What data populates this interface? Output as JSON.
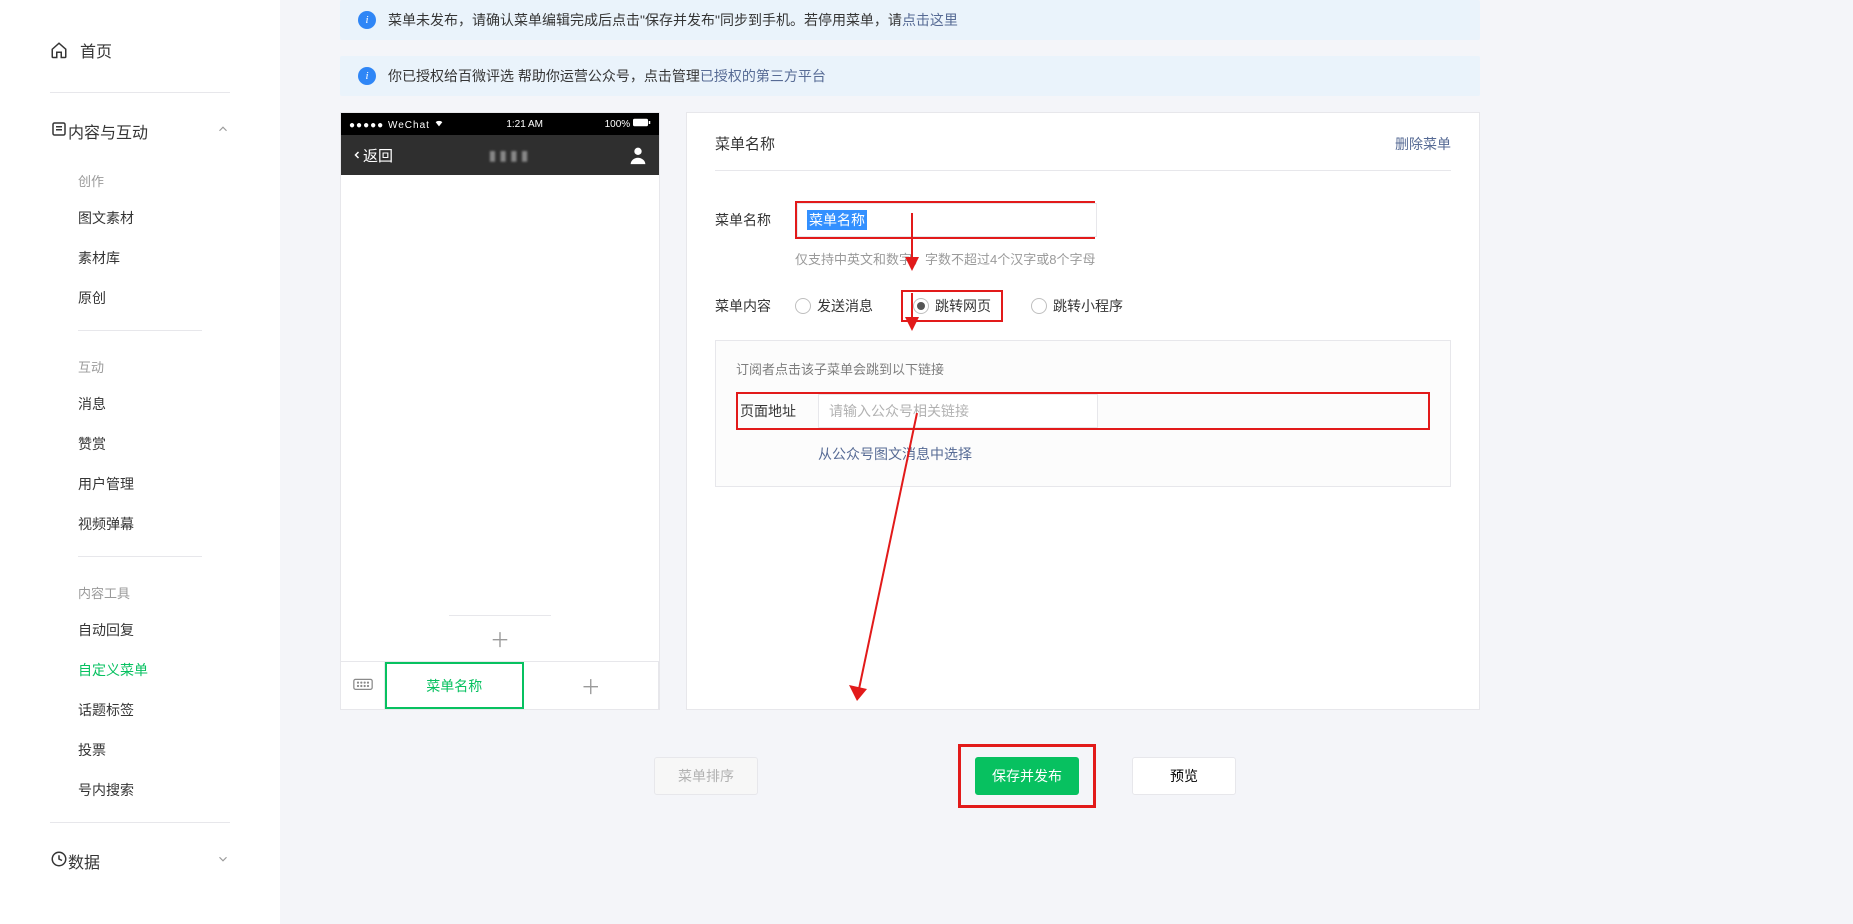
{
  "sidebar": {
    "home": "首页",
    "section_content": "内容与互动",
    "groups": {
      "create": {
        "label": "创作",
        "items": [
          "图文素材",
          "素材库",
          "原创"
        ]
      },
      "interact": {
        "label": "互动",
        "items": [
          "消息",
          "赞赏",
          "用户管理",
          "视频弹幕"
        ]
      },
      "tools": {
        "label": "内容工具",
        "items": [
          "自动回复",
          "自定义菜单",
          "话题标签",
          "投票",
          "号内搜索"
        ]
      }
    },
    "data": "数据"
  },
  "banners": {
    "b1_prefix": "菜单未发布，请确认菜单编辑完成后点击\"保存并发布\"同步到手机。若停用菜单，请",
    "b1_link": "点击这里",
    "b2_prefix": "你已授权给百微评选  帮助你运营公众号，点击管理",
    "b2_link": "已授权的第三方平台"
  },
  "phone": {
    "status_left": "●●●●● WeChat",
    "status_wifi": "",
    "status_time": "1:21 AM",
    "status_batt": "100%",
    "back": "返回",
    "menu_active": "菜单名称"
  },
  "editor": {
    "header_title": "菜单名称",
    "delete": "删除菜单",
    "name_label": "菜单名称",
    "name_value": "菜单名称",
    "name_hint": "仅支持中英文和数字，字数不超过4个汉字或8个字母",
    "content_label": "菜单内容",
    "opt_send": "发送消息",
    "opt_url": "跳转网页",
    "opt_mini": "跳转小程序",
    "link_desc": "订阅者点击该子菜单会跳到以下链接",
    "url_label": "页面地址",
    "url_placeholder": "请输入公众号相关链接",
    "pick_link": "从公众号图文消息中选择"
  },
  "actions": {
    "sort": "菜单排序",
    "save": "保存并发布",
    "preview": "预览"
  }
}
